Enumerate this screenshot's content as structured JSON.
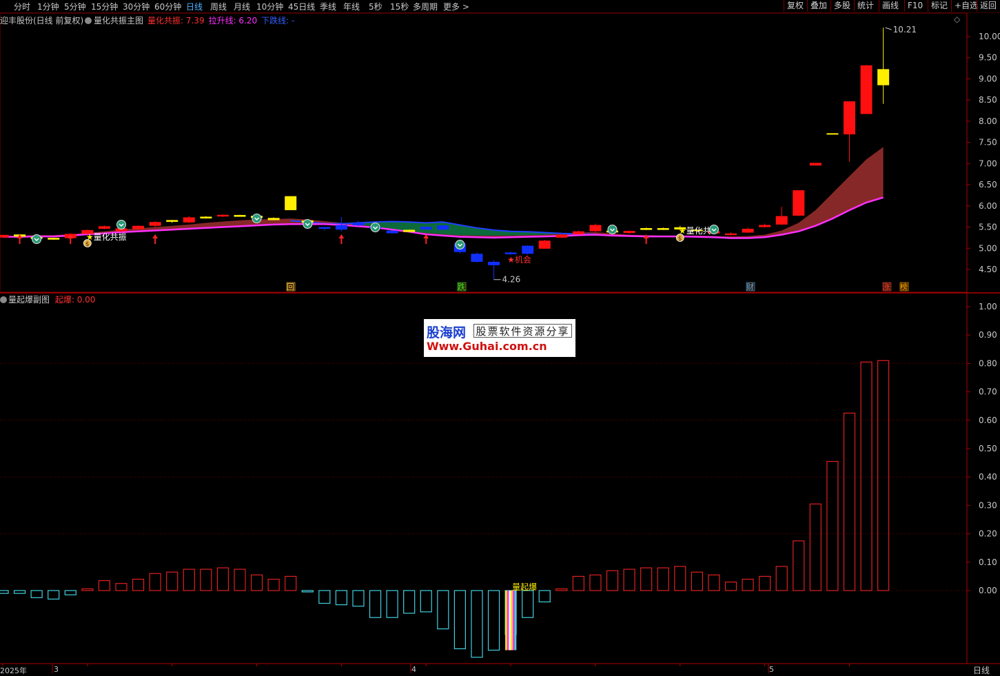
{
  "periods": [
    "分时",
    "1分钟",
    "5分钟",
    "15分钟",
    "30分钟",
    "60分钟",
    "日线",
    "周线",
    "月线",
    "10分钟",
    "45日线",
    "季线",
    "年线",
    "5秒",
    "15秒",
    "多周期",
    "更多 >"
  ],
  "active_period": "日线",
  "right_buttons": [
    "复权",
    "叠加",
    "多股",
    "统计",
    "画线",
    "F10",
    "标记",
    "+自选",
    "返回"
  ],
  "main": {
    "title": "迎丰股份(日线 前复权)",
    "indicator": "量化共振主图",
    "legend": [
      {
        "label": "量化共振: 7.39",
        "color": "#ff3030"
      },
      {
        "label": "拉升线: 6.20",
        "color": "#ff30ff"
      },
      {
        "label": "下跌线: -",
        "color": "#3060ff"
      }
    ],
    "y_ticks": [
      "10.00",
      "9.50",
      "9.00",
      "8.50",
      "8.00",
      "7.50",
      "7.00",
      "6.50",
      "6.00",
      "5.50",
      "5.00",
      "4.50"
    ],
    "high_label": "10.21",
    "low_label": "4.26",
    "annotations": {
      "signal1": "量化共振",
      "signal2": "量化共",
      "chance": "机会"
    },
    "markers": [
      {
        "text": "回",
        "color": "#ffd24a"
      },
      {
        "text": "跌",
        "color": "#30ff30"
      },
      {
        "text": "财",
        "color": "#4fb0ff"
      },
      {
        "text": "涨",
        "color": "#ff4040"
      },
      {
        "text": "榜",
        "color": "#ffb000"
      }
    ]
  },
  "sub": {
    "indicator": "量起爆副图",
    "legend": "起爆: 0.00",
    "y_ticks": [
      "1.00",
      "0.90",
      "0.80",
      "0.70",
      "0.60",
      "0.50",
      "0.40",
      "0.30",
      "0.20",
      "0.10",
      "0.00"
    ],
    "signal": "量起爆"
  },
  "watermark": {
    "brand": "股海网",
    "slogan": "股票软件资源分享",
    "url": "Www.Guhai.com.cn"
  },
  "bottom": {
    "year": "2025年",
    "months": [
      "3",
      "4",
      "5"
    ],
    "period_label": "日线"
  },
  "chart_data": [
    {
      "type": "candlestick",
      "ylim": [
        4.1,
        10.4
      ],
      "candles": [
        [
          5.27,
          5.3,
          5.25,
          5.3
        ],
        [
          5.29,
          5.33,
          5.26,
          5.31
        ],
        [
          5.25,
          5.28,
          5.22,
          5.24
        ],
        [
          5.23,
          5.25,
          5.2,
          5.22
        ],
        [
          5.24,
          5.35,
          5.23,
          5.34
        ],
        [
          5.34,
          5.44,
          5.33,
          5.43
        ],
        [
          5.46,
          5.54,
          5.45,
          5.52
        ],
        [
          5.4,
          5.5,
          5.38,
          5.47
        ],
        [
          5.45,
          5.54,
          5.44,
          5.53
        ],
        [
          5.53,
          5.64,
          5.5,
          5.62
        ],
        [
          5.64,
          5.67,
          5.6,
          5.65
        ],
        [
          5.61,
          5.76,
          5.6,
          5.73
        ],
        [
          5.72,
          5.76,
          5.7,
          5.73
        ],
        [
          5.75,
          5.8,
          5.74,
          5.79
        ],
        [
          5.76,
          5.79,
          5.75,
          5.77
        ],
        [
          5.75,
          5.8,
          5.7,
          5.73
        ],
        [
          5.68,
          5.73,
          5.66,
          5.7
        ],
        [
          5.9,
          6.23,
          5.9,
          6.23
        ],
        [
          5.62,
          5.67,
          5.6,
          5.64
        ],
        [
          5.5,
          5.48,
          5.42,
          5.46
        ],
        [
          5.55,
          5.74,
          5.4,
          5.44
        ],
        [
          5.6,
          5.65,
          5.52,
          5.54
        ],
        [
          5.51,
          5.54,
          5.45,
          5.47
        ],
        [
          5.4,
          5.42,
          5.35,
          5.37
        ],
        [
          5.42,
          5.44,
          5.38,
          5.4
        ],
        [
          5.49,
          5.51,
          5.44,
          5.46
        ],
        [
          5.54,
          5.53,
          5.43,
          5.44
        ],
        [
          5.11,
          5.13,
          4.88,
          4.91
        ],
        [
          4.87,
          4.9,
          4.66,
          4.68
        ],
        [
          4.68,
          4.72,
          4.26,
          4.6
        ],
        [
          4.9,
          4.92,
          4.84,
          4.86
        ],
        [
          5.06,
          5.07,
          4.85,
          4.87
        ],
        [
          4.99,
          5.2,
          4.99,
          5.18
        ],
        [
          5.25,
          5.33,
          5.24,
          5.32
        ],
        [
          5.33,
          5.42,
          5.32,
          5.4
        ],
        [
          5.4,
          5.58,
          5.39,
          5.55
        ],
        [
          5.39,
          5.42,
          5.38,
          5.4
        ],
        [
          5.36,
          5.42,
          5.34,
          5.41
        ],
        [
          5.45,
          5.49,
          5.43,
          5.46
        ],
        [
          5.45,
          5.49,
          5.43,
          5.46
        ],
        [
          5.46,
          5.53,
          5.44,
          5.48
        ],
        [
          5.42,
          5.44,
          5.4,
          5.42
        ],
        [
          5.35,
          5.41,
          5.34,
          5.4
        ],
        [
          5.31,
          5.38,
          5.3,
          5.35
        ],
        [
          5.37,
          5.49,
          5.36,
          5.46
        ],
        [
          5.5,
          5.58,
          5.49,
          5.55
        ],
        [
          5.56,
          5.98,
          5.55,
          5.76
        ],
        [
          5.77,
          6.37,
          5.76,
          6.37
        ],
        [
          6.97,
          7.0,
          6.96,
          7.0
        ],
        [
          7.7,
          7.7,
          7.7,
          7.7
        ],
        [
          7.69,
          8.47,
          7.04,
          8.47
        ],
        [
          8.17,
          9.33,
          8.17,
          9.32
        ],
        [
          9.23,
          10.21,
          8.41,
          8.85
        ]
      ],
      "series": [
        {
          "name": "拉升线",
          "values": [
            5.27,
            5.27,
            5.28,
            5.28,
            5.3,
            5.33,
            5.35,
            5.38,
            5.4,
            5.42,
            5.44,
            5.46,
            5.48,
            5.5,
            5.52,
            5.54,
            5.56,
            5.57,
            5.57,
            5.57,
            5.55,
            5.52,
            5.49,
            5.44,
            5.39,
            5.33,
            5.3,
            5.27,
            5.26,
            5.25,
            5.26,
            5.27,
            5.28,
            5.29,
            5.31,
            5.32,
            5.3,
            5.29,
            5.28,
            5.28,
            5.28,
            5.27,
            5.26,
            5.24,
            5.24,
            5.26,
            5.32,
            5.4,
            5.53,
            5.7,
            5.9,
            6.08,
            6.2
          ]
        },
        {
          "name": "量化共振",
          "values": [
            5.29,
            5.3,
            5.31,
            5.31,
            5.33,
            5.36,
            5.4,
            5.44,
            5.47,
            5.5,
            5.53,
            5.56,
            5.6,
            5.63,
            5.66,
            5.68,
            5.69,
            5.7,
            5.68,
            5.64,
            5.6,
            5.56,
            5.51,
            5.45,
            5.4,
            5.36,
            5.33,
            5.31,
            5.3,
            5.3,
            5.3,
            5.31,
            5.32,
            5.34,
            5.37,
            5.38,
            5.35,
            5.32,
            5.31,
            5.3,
            5.3,
            5.3,
            5.29,
            5.28,
            5.29,
            5.32,
            5.42,
            5.6,
            5.9,
            6.3,
            6.7,
            7.1,
            7.39
          ]
        },
        {
          "name": "下跌线",
          "values": [
            null,
            null,
            null,
            null,
            null,
            null,
            null,
            null,
            null,
            null,
            null,
            null,
            null,
            null,
            null,
            null,
            null,
            5.65,
            5.62,
            5.58,
            5.58,
            5.6,
            5.62,
            5.63,
            5.62,
            5.6,
            5.62,
            5.55,
            5.48,
            5.43,
            5.4,
            5.39,
            5.37,
            5.35,
            5.34,
            5.33,
            null,
            null,
            null,
            null,
            null,
            null,
            null,
            null,
            null,
            null,
            null,
            null,
            null,
            null,
            null,
            null,
            null
          ]
        }
      ]
    },
    {
      "type": "bar",
      "title": "量起爆副图",
      "ylim": [
        -0.24,
        1.05
      ],
      "values": [
        -0.01,
        -0.01,
        -0.025,
        -0.03,
        -0.015,
        0.006,
        0.035,
        0.025,
        0.04,
        0.06,
        0.065,
        0.075,
        0.075,
        0.08,
        0.075,
        0.055,
        0.04,
        0.05,
        -0.003,
        -0.045,
        -0.05,
        -0.055,
        -0.095,
        -0.095,
        -0.08,
        -0.075,
        -0.135,
        -0.205,
        -0.235,
        -0.21,
        -0.155,
        -0.095,
        -0.04,
        0.006,
        0.05,
        0.055,
        0.07,
        0.075,
        0.08,
        0.08,
        0.085,
        0.065,
        0.055,
        0.03,
        0.04,
        0.05,
        0.085,
        0.175,
        0.305,
        0.455,
        0.625,
        0.805,
        0.81
      ]
    }
  ]
}
